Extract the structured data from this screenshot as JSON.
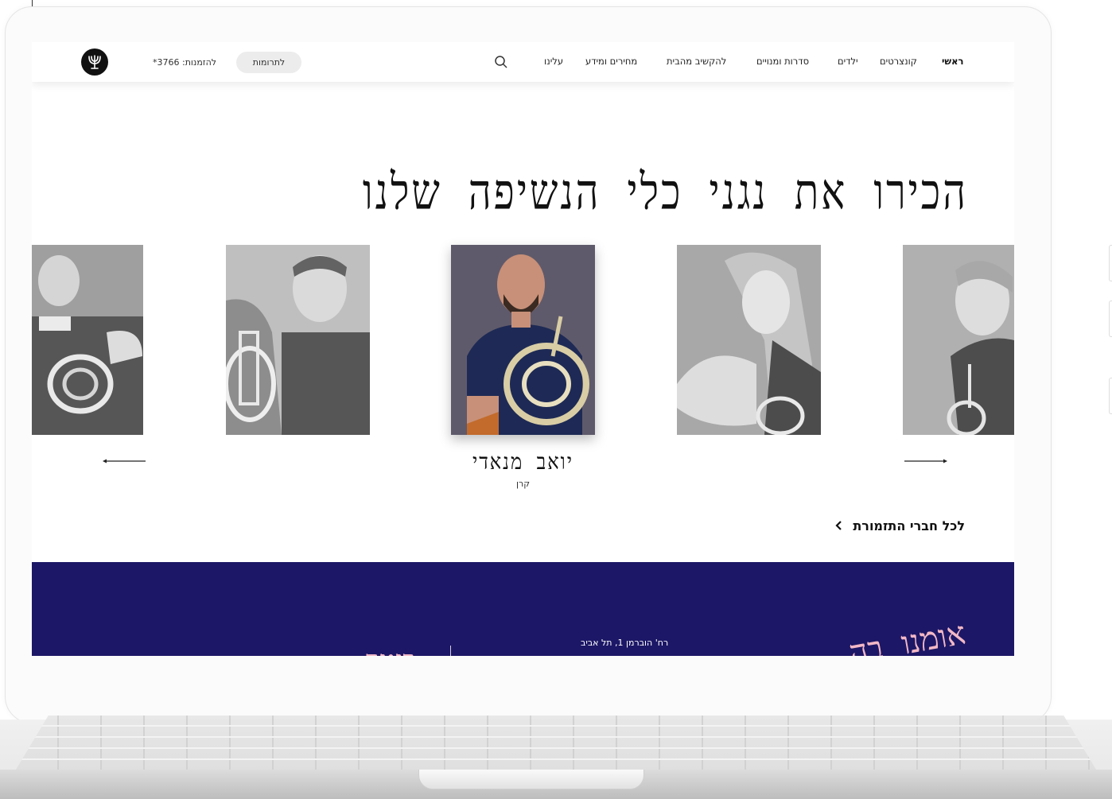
{
  "nav": {
    "items": [
      {
        "label": "ראשי"
      },
      {
        "label": "קונצרטים"
      },
      {
        "label": "ילדים"
      },
      {
        "label": "סדרות ומנויים"
      },
      {
        "label": "להקשיב מהבית"
      },
      {
        "label": "מחירים ומידע"
      },
      {
        "label": "עלינו"
      }
    ],
    "donate_label": "לתרומות",
    "phone_text": "להזמנות: 3766*"
  },
  "section": {
    "title": "הכירו את נגני כלי הנשיפה שלנו",
    "featured_player": {
      "name": "יואב מנאדי",
      "instrument": "קרן"
    },
    "all_members_link": "לכל חברי התזמורת"
  },
  "footer": {
    "address": "רח' הוברמן 1, תל אביב",
    "brand_partial": "אומנו בה",
    "brand_partial_2": "ביטר",
    "background_color": "#1c1766",
    "accent_color": "#f2b8c6"
  },
  "icons": {
    "search": "search-icon",
    "logo": "menorah-logo-icon",
    "prev": "arrow-left-icon",
    "next": "arrow-right-icon",
    "link_chevron": "chevron-left-icon"
  }
}
